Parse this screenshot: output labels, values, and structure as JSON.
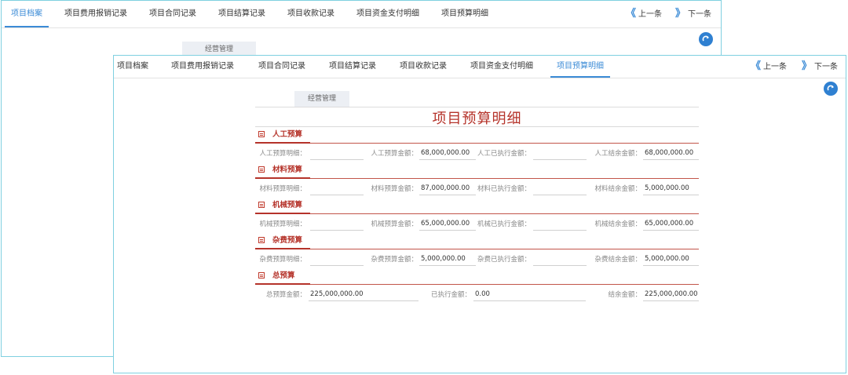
{
  "tabs": [
    "项目档案",
    "项目费用报销记录",
    "项目合同记录",
    "项目结算记录",
    "项目收款记录",
    "项目资金支付明细",
    "项目预算明细"
  ],
  "nav": {
    "prev_icon": "《",
    "prev": "上一条",
    "next_icon": "》",
    "next": "下一条"
  },
  "refresh_icon": "refresh-icon",
  "pill_label": "经营管理",
  "form_title": "项目预算明细",
  "sections": [
    {
      "title": "人工预算",
      "detail_label": "人工预算明细：",
      "amount_label": "人工预算金额：",
      "amount": "68,000,000.00",
      "executed_label": "人工已执行金额：",
      "executed": "",
      "remain_label": "人工结余金额：",
      "remain": "68,000,000.00"
    },
    {
      "title": "材料预算",
      "detail_label": "材料预算明细：",
      "amount_label": "材料预算金额：",
      "amount": "87,000,000.00",
      "executed_label": "材料已执行金额：",
      "executed": "",
      "remain_label": "材料结余金额：",
      "remain": "5,000,000.00"
    },
    {
      "title": "机械预算",
      "detail_label": "机械预算明细：",
      "amount_label": "机械预算金额：",
      "amount": "65,000,000.00",
      "executed_label": "机械已执行金额：",
      "executed": "",
      "remain_label": "机械结余金额：",
      "remain": "65,000,000.00"
    },
    {
      "title": "杂费预算",
      "detail_label": "杂费预算明细：",
      "amount_label": "杂费预算金额：",
      "amount": "5,000,000.00",
      "executed_label": "杂费已执行金额：",
      "executed": "",
      "remain_label": "杂费结余金额：",
      "remain": "5,000,000.00"
    }
  ],
  "total": {
    "title": "总预算",
    "amount_label": "总预算金额：",
    "amount": "225,000,000.00",
    "executed_label": "已执行金额：",
    "executed": "0.00",
    "remain_label": "结余金额：",
    "remain": "225,000,000.00"
  },
  "colors": {
    "accent": "#3b8bd6",
    "section": "#b5332a",
    "frame": "#7fd0e0"
  }
}
